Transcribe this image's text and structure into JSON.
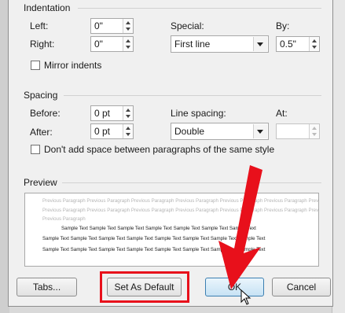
{
  "indentation": {
    "title": "Indentation",
    "left_label": "Left:",
    "left_value": "0\"",
    "right_label": "Right:",
    "right_value": "0\"",
    "special_label": "Special:",
    "special_value": "First line",
    "by_label": "By:",
    "by_value": "0.5\"",
    "mirror_label": "Mirror indents"
  },
  "spacing": {
    "title": "Spacing",
    "before_label": "Before:",
    "before_value": "0 pt",
    "after_label": "After:",
    "after_value": "0 pt",
    "line_spacing_label": "Line spacing:",
    "line_spacing_value": "Double",
    "at_label": "At:",
    "at_value": "",
    "dont_add_label": "Don't add space between paragraphs of the same style"
  },
  "preview": {
    "title": "Preview",
    "previous_lines": [
      "Previous Paragraph Previous Paragraph Previous Paragraph Previous Paragraph Previous Paragraph Previous Paragraph Previous Paragraph",
      "Previous Paragraph Previous Paragraph Previous Paragraph Previous Paragraph Previous Paragraph Previous Paragraph Previous Paragraph",
      "Previous Paragraph"
    ],
    "sample_lines": [
      "Sample Text Sample Text Sample Text Sample Text Sample Text Sample Text Sample Text",
      "Sample Text Sample Text Sample Text Sample Text Sample Text Sample Text Sample Text Sample Text",
      "Sample Text Sample Text Sample Text Sample Text Sample Text Sample Text Sample Text Sample Text"
    ]
  },
  "buttons": {
    "tabs": "Tabs...",
    "set_default": "Set As Default",
    "ok": "OK",
    "cancel": "Cancel"
  },
  "annotation_color": "#e8101b"
}
